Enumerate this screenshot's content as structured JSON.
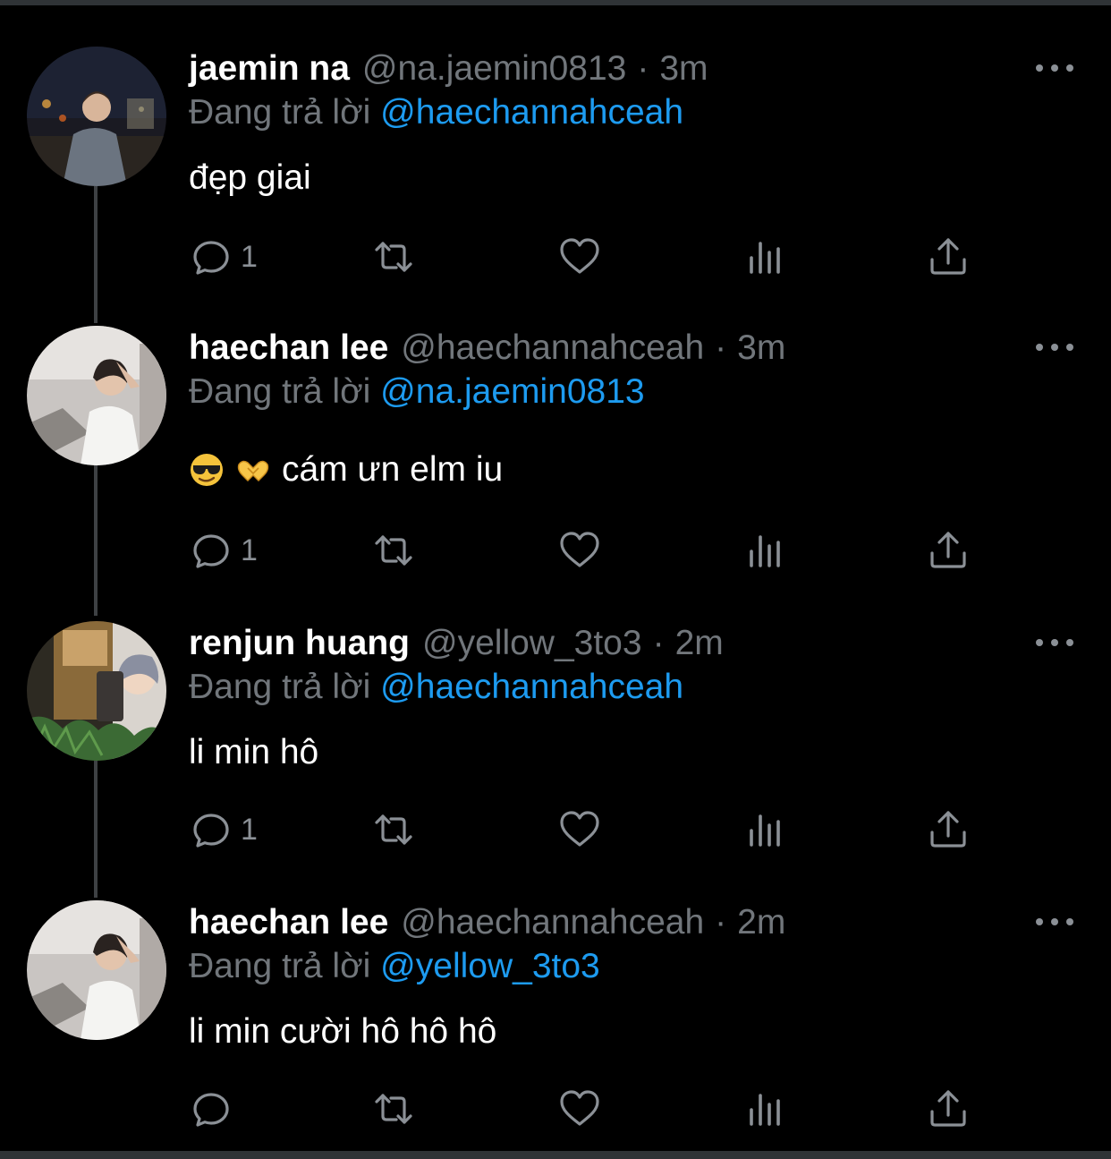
{
  "colors": {
    "background": "#000000",
    "text": "#e7e9ea",
    "muted": "#71767b",
    "link": "#1d9bf0",
    "divider": "#2f3336"
  },
  "reply_prefix": "Đang trả lời",
  "tweets": [
    {
      "name": "jaemin na",
      "handle": "@na.jaemin0813",
      "separator": "·",
      "time": "3m",
      "reply_to": "@haechannahceah",
      "text": "đẹp giai",
      "reply_count": "1"
    },
    {
      "name": "haechan lee",
      "handle": "@haechannahceah",
      "separator": "·",
      "time": "3m",
      "reply_to": "@na.jaemin0813",
      "text": "cám ưn elm iu",
      "emojis": [
        "sunglasses-emoji",
        "heart-hands-emoji"
      ],
      "reply_count": "1"
    },
    {
      "name": "renjun huang",
      "handle": "@yellow_3to3",
      "separator": "·",
      "time": "2m",
      "reply_to": "@haechannahceah",
      "text": "li min hô",
      "reply_count": "1"
    },
    {
      "name": "haechan lee",
      "handle": "@haechannahceah",
      "separator": "·",
      "time": "2m",
      "reply_to": "@yellow_3to3",
      "text": "li min cười hô hô hô",
      "reply_count": ""
    }
  ],
  "icons": [
    "reply-icon",
    "retweet-icon",
    "like-icon",
    "views-icon",
    "share-icon",
    "more-options-icon"
  ]
}
